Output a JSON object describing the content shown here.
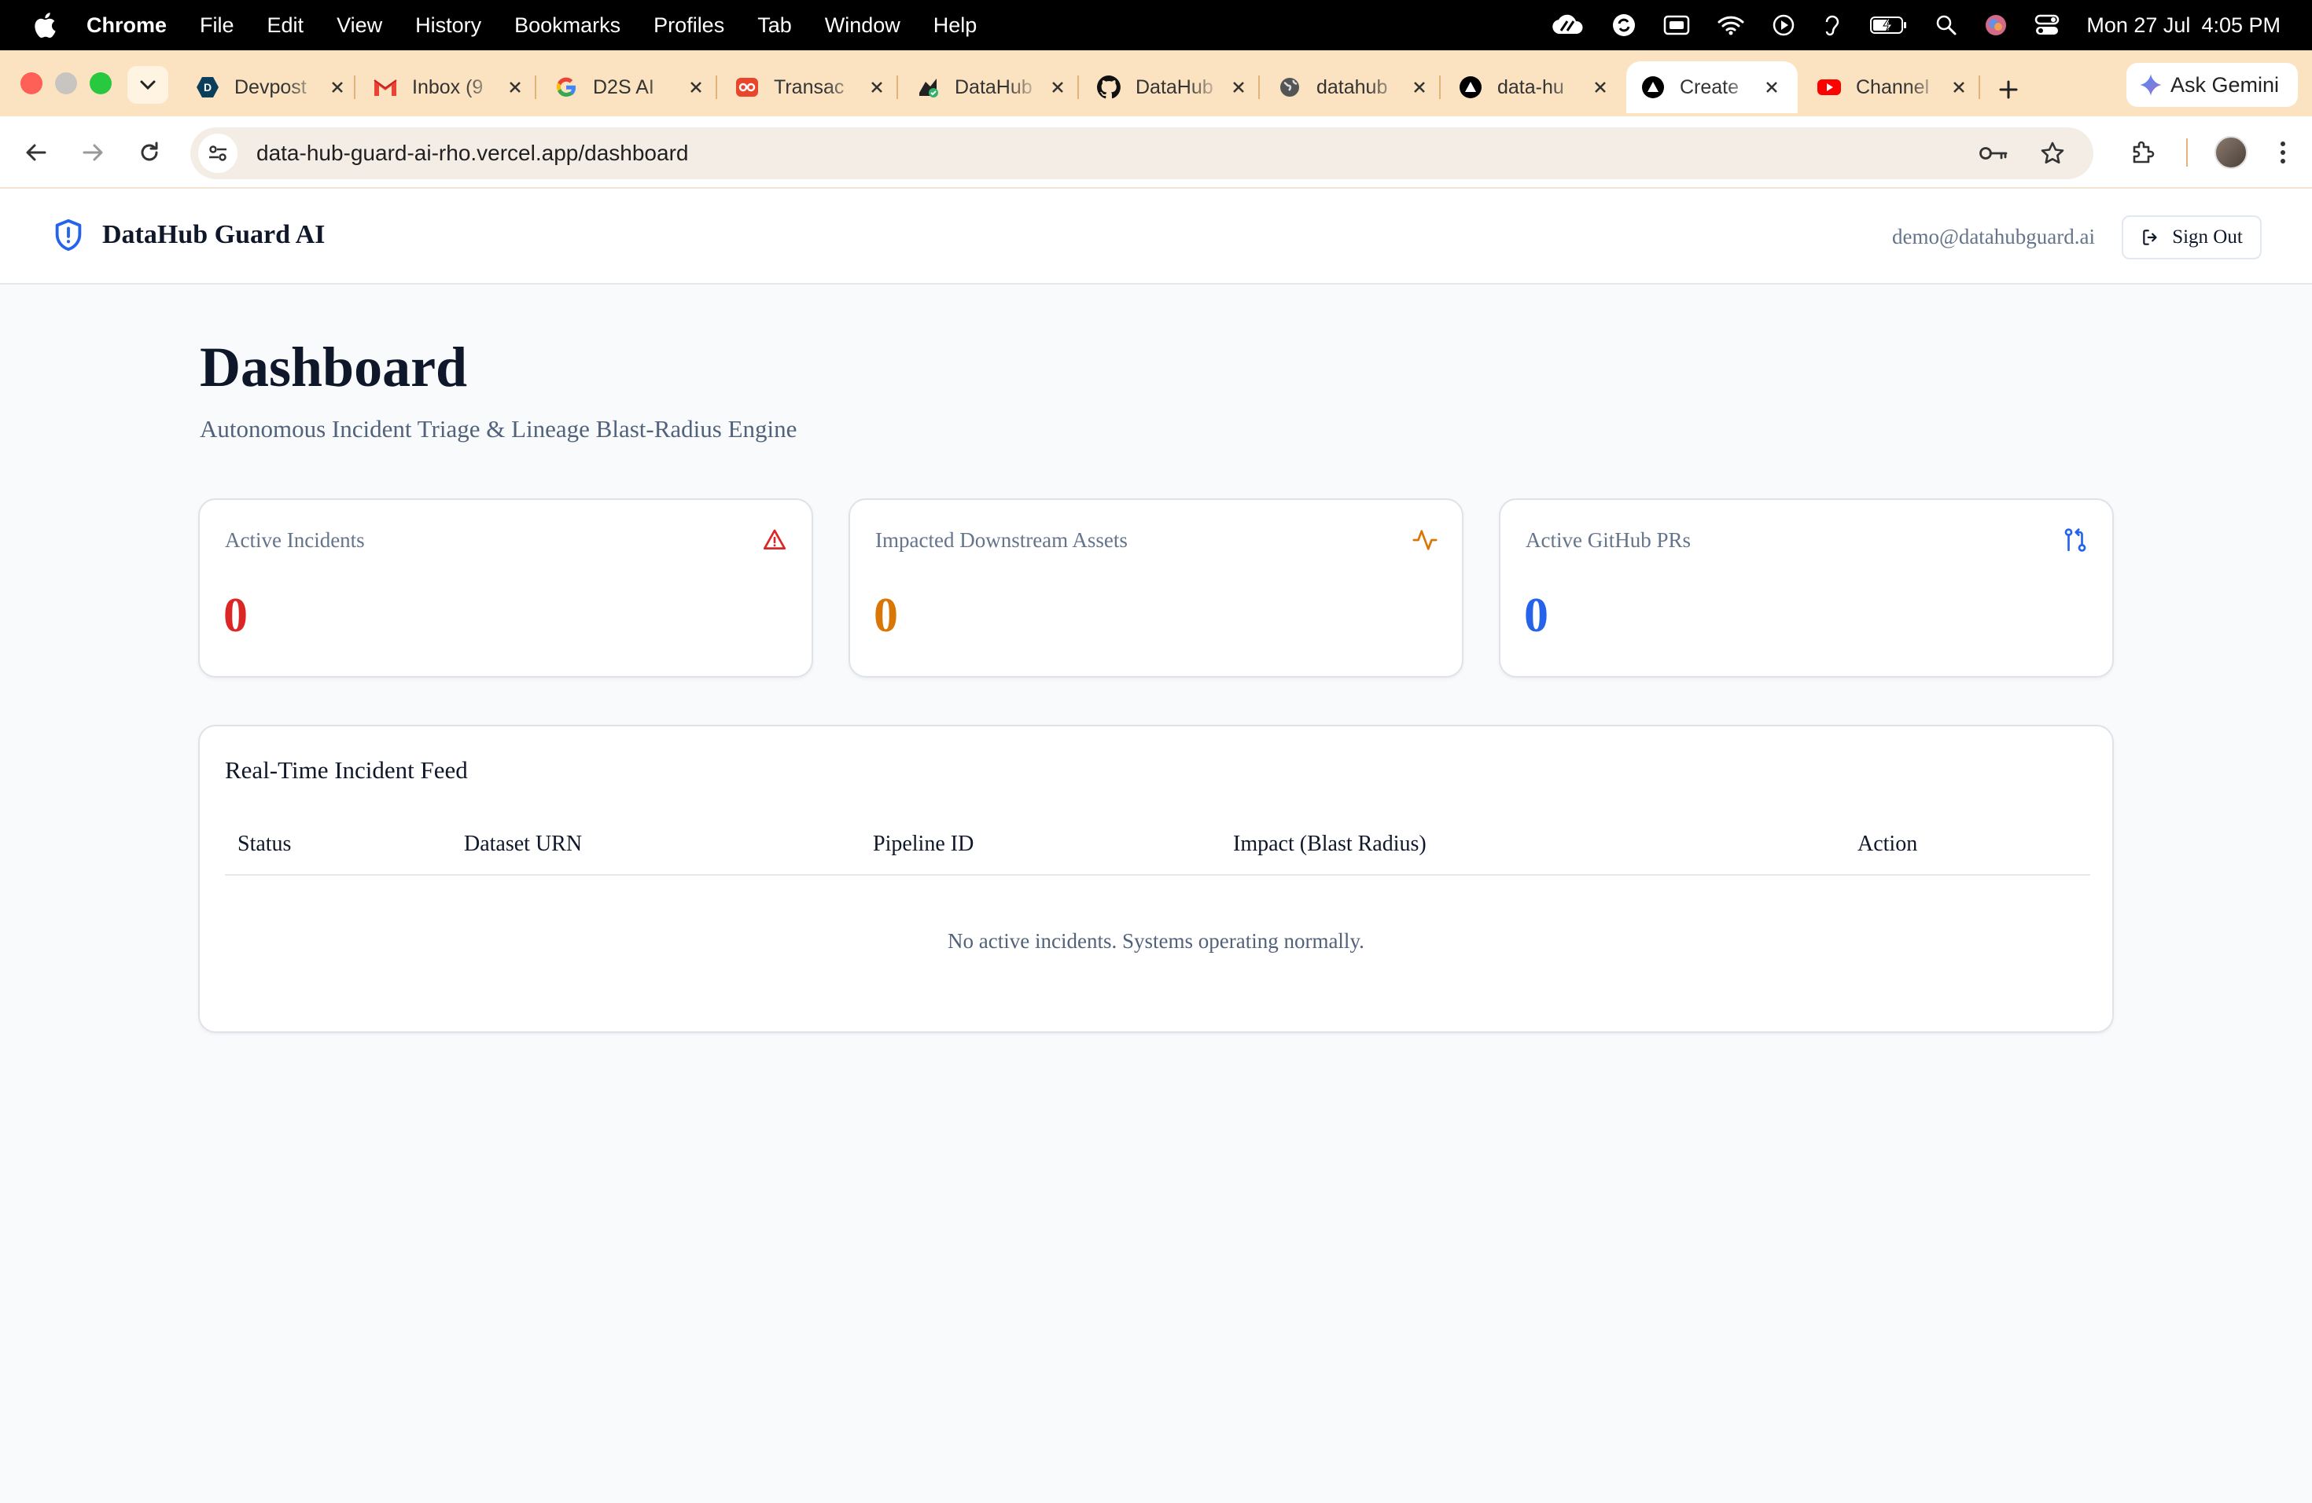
{
  "menubar": {
    "app": "Chrome",
    "items": [
      "File",
      "Edit",
      "View",
      "History",
      "Bookmarks",
      "Profiles",
      "Tab",
      "Window",
      "Help"
    ],
    "date": "Mon 27 Jul",
    "time": "4:05 PM"
  },
  "tabs": [
    {
      "title": "Devpost",
      "icon": "devpost-icon",
      "color": "#0a3e5a"
    },
    {
      "title": "Inbox (9",
      "icon": "gmail-icon",
      "color": "#ea4335"
    },
    {
      "title": "D2S AI",
      "icon": "google-icon",
      "color": "#4285f4"
    },
    {
      "title": "Transac",
      "icon": "transaction-icon",
      "color": "#e8452c"
    },
    {
      "title": "DataHub",
      "icon": "datahub-icon",
      "color": "#222222"
    },
    {
      "title": "DataHub",
      "icon": "github-icon",
      "color": "#111111"
    },
    {
      "title": "datahub",
      "icon": "globe-icon",
      "color": "#555555"
    },
    {
      "title": "data-hu",
      "icon": "vercel-icon",
      "color": "#000000"
    },
    {
      "title": "Create",
      "icon": "vercel-icon",
      "color": "#000000",
      "active": true
    },
    {
      "title": "Channel",
      "icon": "youtube-icon",
      "color": "#ff0000"
    }
  ],
  "gemini_label": "Ask Gemini",
  "address": {
    "host": "data-hub-guard-ai-rho.vercel.app",
    "path": "/dashboard"
  },
  "header": {
    "brand": "DataHub Guard AI",
    "email": "demo@datahubguard.ai",
    "signout_label": "Sign Out"
  },
  "page": {
    "title": "Dashboard",
    "subtitle": "Autonomous Incident Triage & Lineage Blast-Radius Engine"
  },
  "stats": [
    {
      "label": "Active Incidents",
      "value": "0",
      "color": "#dc2626",
      "icon": "alert-triangle-icon"
    },
    {
      "label": "Impacted Downstream Assets",
      "value": "0",
      "color": "#d97706",
      "icon": "activity-icon"
    },
    {
      "label": "Active GitHub PRs",
      "value": "0",
      "color": "#2563eb",
      "icon": "git-pull-request-icon"
    }
  ],
  "feed": {
    "title": "Real-Time Incident Feed",
    "columns": [
      "Status",
      "Dataset URN",
      "Pipeline ID",
      "Impact (Blast Radius)",
      "Action"
    ],
    "empty_message": "No active incidents. Systems operating normally."
  },
  "colors": {
    "brand_blue": "#2563eb",
    "tab_strip": "#fbe3c2"
  }
}
